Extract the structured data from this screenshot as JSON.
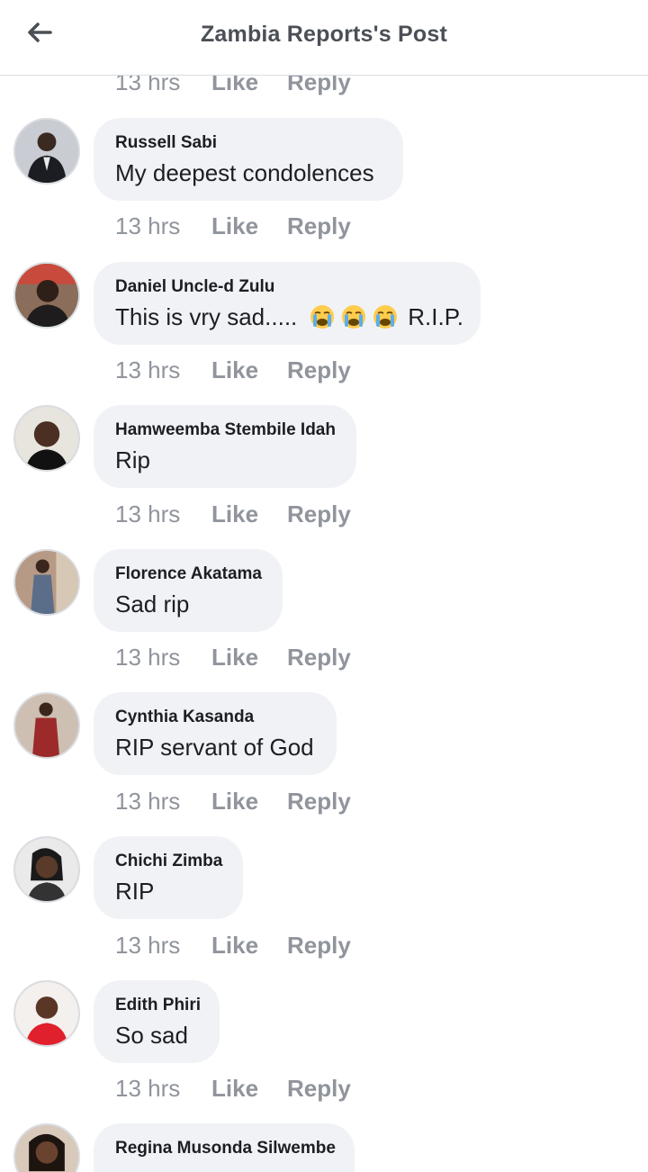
{
  "header": {
    "title": "Zambia Reports's Post",
    "back_icon": "arrow-left-icon"
  },
  "colors": {
    "bubble_bg": "#f0f2f5",
    "meta_text": "#90949c",
    "title_text": "#4b4f56"
  },
  "top_meta": {
    "time": "13 hrs",
    "like": "Like",
    "reply": "Reply"
  },
  "comments": [
    {
      "name": "Russell Sabi",
      "text": "My deepest condolences",
      "time": "13 hrs",
      "like": "Like",
      "reply": "Reply"
    },
    {
      "name": "Daniel Uncle-d Zulu",
      "text": "This is vry sad.....",
      "emoji": "loudly-crying-face-icon",
      "text_after": "R.I.P.",
      "time": "13 hrs",
      "like": "Like",
      "reply": "Reply"
    },
    {
      "name": "Hamweemba Stembile Idah",
      "text": "Rip",
      "time": "13 hrs",
      "like": "Like",
      "reply": "Reply"
    },
    {
      "name": "Florence Akatama",
      "text": "Sad rip",
      "time": "13 hrs",
      "like": "Like",
      "reply": "Reply"
    },
    {
      "name": "Cynthia Kasanda",
      "text": "RIP servant of God",
      "time": "13 hrs",
      "like": "Like",
      "reply": "Reply"
    },
    {
      "name": "Chichi Zimba",
      "text": "RIP",
      "time": "13 hrs",
      "like": "Like",
      "reply": "Reply"
    },
    {
      "name": "Edith Phiri",
      "text": "So sad",
      "time": "13 hrs",
      "like": "Like",
      "reply": "Reply"
    },
    {
      "name": "Regina Musonda Silwembe"
    }
  ]
}
